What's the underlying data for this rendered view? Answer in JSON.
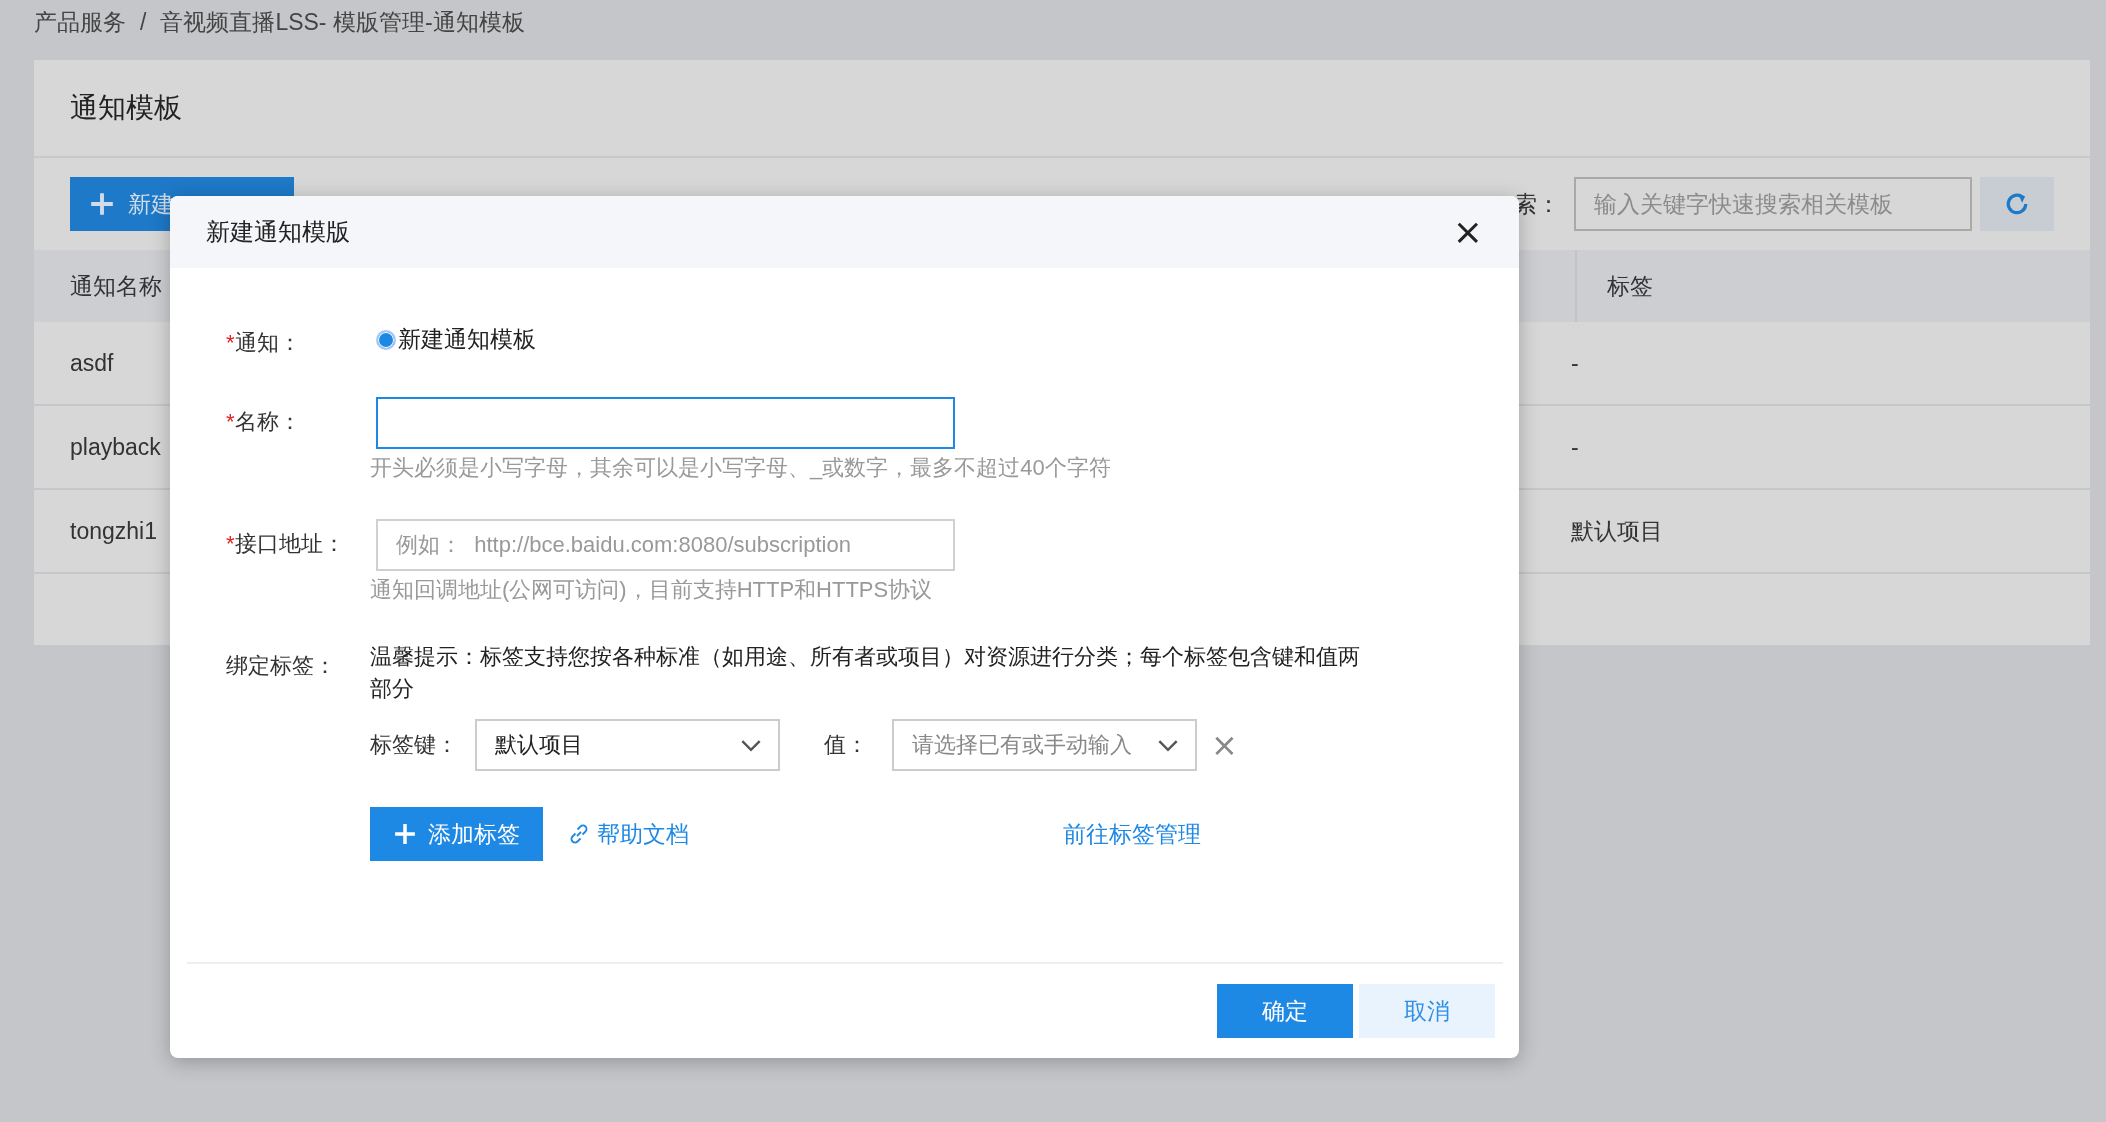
{
  "breadcrumb": [
    {
      "label": "产品服务"
    },
    {
      "label": "/"
    },
    {
      "label": "音视频直播LSS- 模版管理-通知模板"
    }
  ],
  "page": {
    "title": "通知模板",
    "new_button": "新建",
    "search_label": "索：",
    "search_placeholder": "输入关键字快速搜索相关模板"
  },
  "table": {
    "columns": [
      "通知名称",
      "标签"
    ],
    "rows": [
      {
        "name": "asdf",
        "tag": "-"
      },
      {
        "name": "playback",
        "tag": "-"
      },
      {
        "name": "tongzhi1",
        "tag": "默认项目"
      }
    ]
  },
  "dialog": {
    "title": "新建通知模版",
    "close": "×",
    "fields": [
      {
        "kind": "radio",
        "required_mark": "*",
        "label": "通知：",
        "options": [
          {
            "label": "新建通知模板",
            "selected": true
          }
        ]
      },
      {
        "kind": "input",
        "required_mark": "*",
        "label": "名称：",
        "focused": true,
        "hint": "开头必须是小写字母，其余可以是小写字母、_或数字，最多不超过40个字符"
      },
      {
        "kind": "input",
        "required_mark": "*",
        "label": "接口地址：",
        "focused": false,
        "placeholder": "例如：  http://bce.baidu.com:8080/subscription",
        "hint": "通知回调地址(公网可访问)，目前支持HTTP和HTTPS协议"
      },
      {
        "kind": "tags",
        "label": "绑定标签：",
        "tip": "温馨提示：标签支持您按各种标准（如用途、所有者或项目）对资源进行分类；每个标签包含键和值两部分",
        "key_label": "标签键：",
        "key_value": "默认项目",
        "value_label": "值：",
        "value_placeholder": "请选择已有或手动输入",
        "remove": "×",
        "add_button": "添加标签",
        "help_link": "帮助文档",
        "manage_link": "前往标签管理"
      }
    ],
    "buttons": [
      {
        "label": "确定",
        "primary": true
      },
      {
        "label": "取消",
        "primary": false
      }
    ]
  }
}
